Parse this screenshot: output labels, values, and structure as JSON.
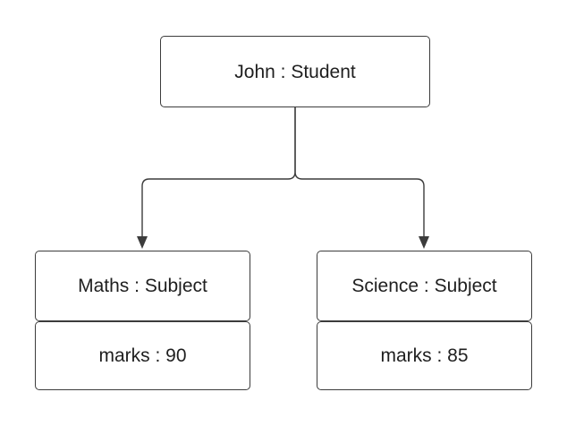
{
  "nodes": {
    "john": {
      "label": "John : Student"
    },
    "maths": {
      "header": "Maths : Subject",
      "attribute": "marks : 90"
    },
    "science": {
      "header": "Science : Subject",
      "attribute": "marks : 85"
    }
  },
  "connections": [
    {
      "from": "John : Student",
      "to": "Maths : Subject"
    },
    {
      "from": "John : Student",
      "to": "Science : Subject"
    }
  ],
  "colors": {
    "stroke": "#3c3c3c",
    "background": "#ffffff",
    "text": "#1f1f1f"
  }
}
